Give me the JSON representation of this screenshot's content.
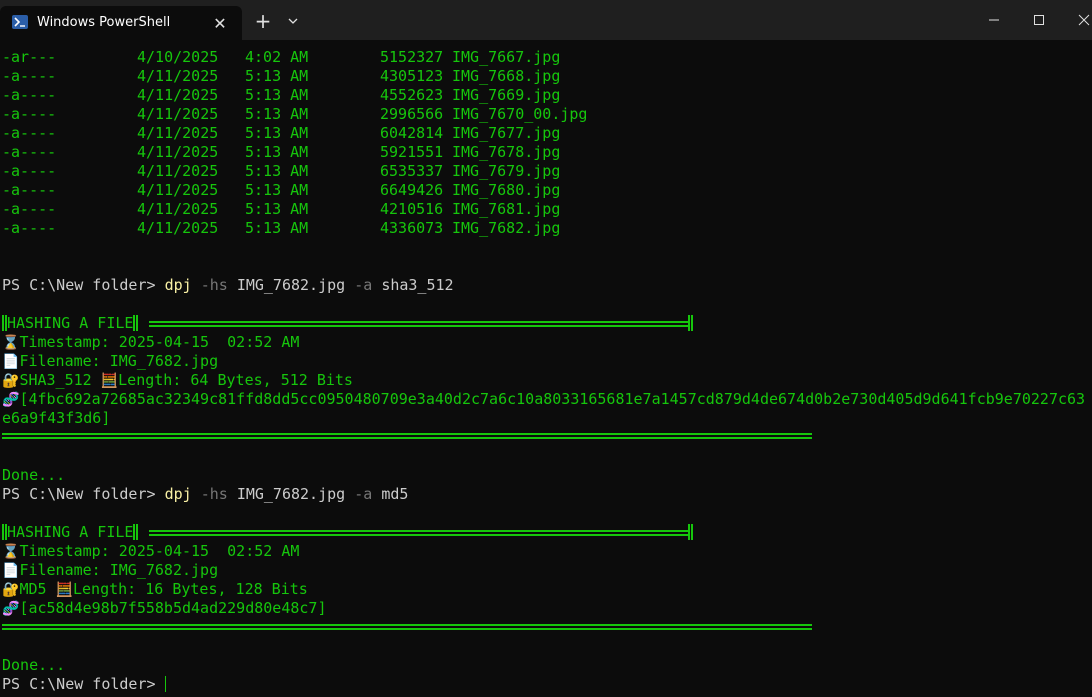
{
  "window": {
    "tab_title": "Windows PowerShell",
    "tab_close": "✕",
    "new_tab": "+"
  },
  "listing": [
    {
      "mode": "-ar---",
      "date": "4/10/2025",
      "time": "4:02 AM",
      "length": "5152327",
      "name": "IMG_7667.jpg"
    },
    {
      "mode": "-a----",
      "date": "4/11/2025",
      "time": "5:13 AM",
      "length": "4305123",
      "name": "IMG_7668.jpg"
    },
    {
      "mode": "-a----",
      "date": "4/11/2025",
      "time": "5:13 AM",
      "length": "4552623",
      "name": "IMG_7669.jpg"
    },
    {
      "mode": "-a----",
      "date": "4/11/2025",
      "time": "5:13 AM",
      "length": "2996566",
      "name": "IMG_7670_00.jpg"
    },
    {
      "mode": "-a----",
      "date": "4/11/2025",
      "time": "5:13 AM",
      "length": "6042814",
      "name": "IMG_7677.jpg"
    },
    {
      "mode": "-a----",
      "date": "4/11/2025",
      "time": "5:13 AM",
      "length": "5921551",
      "name": "IMG_7678.jpg"
    },
    {
      "mode": "-a----",
      "date": "4/11/2025",
      "time": "5:13 AM",
      "length": "6535337",
      "name": "IMG_7679.jpg"
    },
    {
      "mode": "-a----",
      "date": "4/11/2025",
      "time": "5:13 AM",
      "length": "6649426",
      "name": "IMG_7680.jpg"
    },
    {
      "mode": "-a----",
      "date": "4/11/2025",
      "time": "5:13 AM",
      "length": "4210516",
      "name": "IMG_7681.jpg"
    },
    {
      "mode": "-a----",
      "date": "4/11/2025",
      "time": "5:13 AM",
      "length": "4336073",
      "name": "IMG_7682.jpg"
    }
  ],
  "prompt": "PS C:\\New folder> ",
  "commands": [
    {
      "cmd": "dpj",
      "flag1": "-hs",
      "file": "IMG_7682.jpg",
      "flag2": "-a",
      "algo": "sha3_512"
    },
    {
      "cmd": "dpj",
      "flag1": "-hs",
      "file": "IMG_7682.jpg",
      "flag2": "-a",
      "algo": "md5"
    }
  ],
  "hash_blocks": [
    {
      "header": "HASHING A FILE",
      "timestamp_icon": "⌛",
      "timestamp": "Timestamp: 2025-04-15  02:52 AM",
      "filename_icon": "📄",
      "filename": "Filename: IMG_7682.jpg",
      "lock_icon": "🔐",
      "algo": "SHA3_512 ",
      "length_icon": "🧮",
      "length": "Length: 64 Bytes, 512 Bits",
      "hash_icon": "🧬",
      "hash_line1": "[4fbc692a72685ac32349c81ffd8dd5cc0950480709e3a40d2c7a6c10a8033165681e7a1457cd879d4de674d0b2e730d405d9d641fcb9e70227c63",
      "hash_line2": "e6a9f43f3d6]",
      "done": "Done..."
    },
    {
      "header": "HASHING A FILE",
      "timestamp_icon": "⌛",
      "timestamp": "Timestamp: 2025-04-15  02:52 AM",
      "filename_icon": "📄",
      "filename": "Filename: IMG_7682.jpg",
      "lock_icon": "🔐",
      "algo": "MD5 ",
      "length_icon": "🧮",
      "length": "Length: 16 Bytes, 128 Bits",
      "hash_icon": "🧬",
      "hash_line1": "[ac58d4e98b7f558b5d4ad229d80e48c7]",
      "done": "Done..."
    }
  ],
  "colors": {
    "background": "#0c0c0c",
    "output_green": "#16c60c",
    "command_yellow": "#f9f1a5",
    "flag_gray": "#767676",
    "text_white": "#cccccc"
  }
}
